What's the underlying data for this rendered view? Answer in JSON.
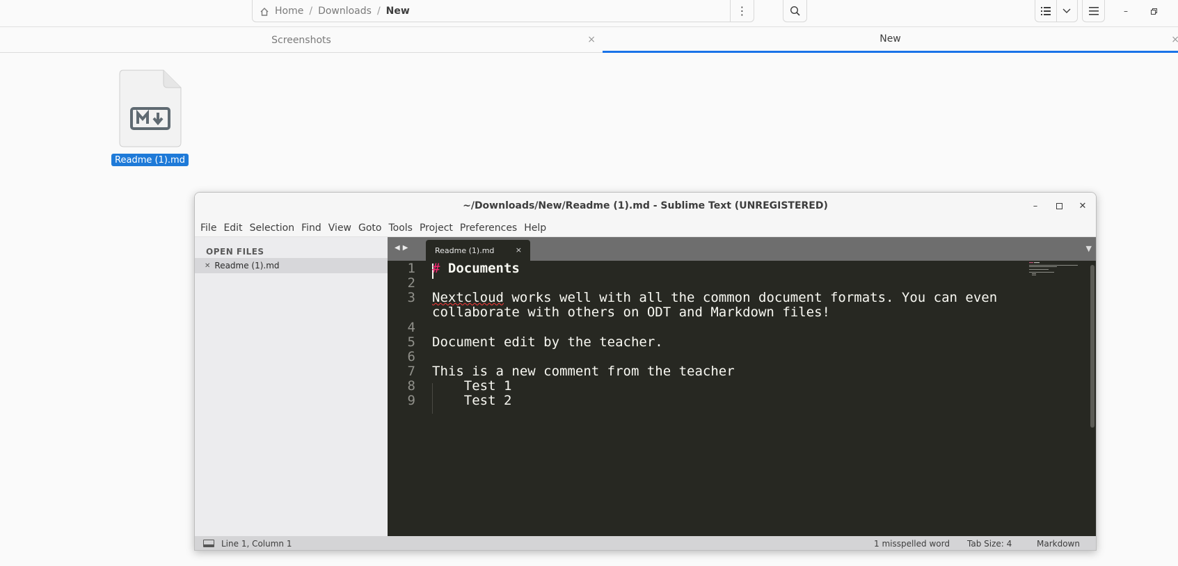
{
  "file_manager": {
    "breadcrumbs": [
      {
        "label": "Home",
        "icon": "home-icon"
      },
      {
        "label": "Downloads"
      },
      {
        "label": "New",
        "current": true
      }
    ],
    "breadcrumb_separator": "/",
    "tabs": [
      {
        "label": "Screenshots",
        "active": false
      },
      {
        "label": "New",
        "active": true
      }
    ],
    "files": [
      {
        "name": "Readme (1).md",
        "icon": "markdown-file-icon",
        "selected": true
      }
    ],
    "accent_color": "#1a73e8"
  },
  "sublime": {
    "title": "~/Downloads/New/Readme (1).md - Sublime Text (UNREGISTERED)",
    "menu": [
      "File",
      "Edit",
      "Selection",
      "Find",
      "View",
      "Goto",
      "Tools",
      "Project",
      "Preferences",
      "Help"
    ],
    "sidebar": {
      "heading": "OPEN FILES",
      "open_files": [
        "Readme (1).md"
      ]
    },
    "tab": {
      "label": "Readme (1).md",
      "close": "×"
    },
    "editor_lines": [
      {
        "number": "1",
        "text": "# Documents"
      },
      {
        "number": "2",
        "text": ""
      },
      {
        "number": "3",
        "text": "Nextcloud works well with all the common document formats. You can even collaborate with others on ODT and Markdown files!"
      },
      {
        "number": "4",
        "text": ""
      },
      {
        "number": "5",
        "text": "Document edit by the teacher."
      },
      {
        "number": "6",
        "text": ""
      },
      {
        "number": "7",
        "text": "This is a new comment from the teacher"
      },
      {
        "number": "8",
        "text": "    Test 1"
      },
      {
        "number": "9",
        "text": "    Test 2"
      }
    ],
    "code": {
      "l1_hash": "#",
      "l1_heading": "Documents",
      "l3a_misspelled": "Nextcloud",
      "l3a_rest": " works well with all the common document formats. You can even",
      "l3b": "collaborate with others on ODT and Markdown files!",
      "l5": "Document edit by the teacher.",
      "l7": "This is a new comment from the teacher",
      "l8": "    Test 1",
      "l9": "    Test 2"
    },
    "status": {
      "position": "Line 1, Column 1",
      "spelling": "1 misspelled word",
      "tab_size": "Tab Size: 4",
      "syntax": "Markdown"
    },
    "colors": {
      "editor_bg": "#272822",
      "heading_hash": "#f92672",
      "text": "#f8f8f2",
      "line_numbers": "#90908a"
    }
  }
}
